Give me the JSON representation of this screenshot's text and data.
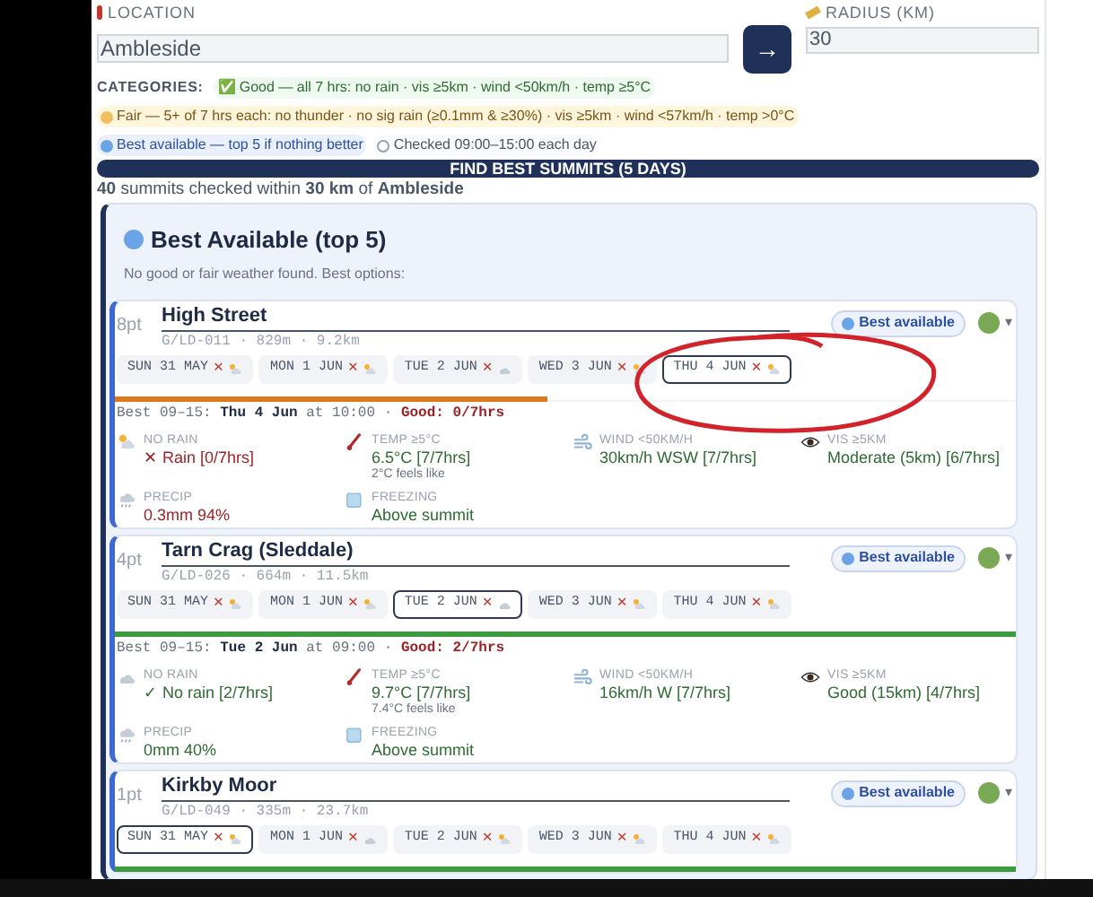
{
  "location": {
    "label": "LOCATION",
    "value": "Ambleside",
    "go": "→"
  },
  "radius": {
    "label": "RADIUS (KM)",
    "value": "30"
  },
  "categories": {
    "label": "CATEGORIES:",
    "items": [
      {
        "kind": "good",
        "icon": "✅",
        "text": "Good — all 7 hrs: no rain · vis ≥5km · wind <50km/h · temp ≥5°C"
      },
      {
        "kind": "fair",
        "text": "Fair — 5+ of 7 hrs each: no thunder · no sig rain (≥0.1mm & ≥30%) · vis ≥5km · wind <57km/h · temp >0°C"
      },
      {
        "kind": "best",
        "text": "Best available — top 5 if nothing better"
      },
      {
        "kind": "info",
        "text": "Checked 09:00–15:00 each day"
      }
    ]
  },
  "find_button": "FIND BEST SUMMITS (5 DAYS)",
  "summary": "**40** summits checked within **30 km** of **Ambleside**",
  "panel": {
    "title": "Best Available (top 5)",
    "subtitle": "No good or fair weather found. Best options:",
    "cards": [
      {
        "points": "8pt",
        "name": "High Street",
        "meta": "G/LD-011 · 829m · 9.2km",
        "badge": "Best available",
        "caret": "▾",
        "days": [
          {
            "label": "SUN 31 MAY",
            "mark": "✕",
            "kind": "sunny",
            "selected": false
          },
          {
            "label": "MON 1 JUN",
            "mark": "✕",
            "kind": "sunny",
            "selected": false
          },
          {
            "label": "TUE 2 JUN",
            "mark": "✕",
            "kind": "cloudy",
            "selected": false
          },
          {
            "label": "WED 3 JUN",
            "mark": "✕",
            "kind": "sunny",
            "selected": false
          },
          {
            "label": "THU 4 JUN",
            "mark": "✕",
            "kind": "sunny",
            "selected": true
          }
        ],
        "bar": {
          "level": 0.48,
          "color": "#d97b1e"
        },
        "best": "Best 09–15: **Thu 4 Jun** at 10:00 · ",
        "good": "Good: 0/7hrs",
        "metrics": [
          {
            "label": "NO RAIN",
            "value": "✕ Rain [0/7hrs]",
            "ok": false
          },
          {
            "label": "TEMP ≥5°C",
            "value": "6.5°C [7/7hrs]",
            "sub": "2°C feels like",
            "ok": true
          },
          {
            "label": "WIND <50KM/H",
            "value": "30km/h WSW [7/7hrs]",
            "ok": true
          },
          {
            "label": "VIS ≥5KM",
            "value": "Moderate (5km) [6/7hrs]",
            "ok": true
          },
          {
            "label": "PRECIP",
            "value": "0.3mm 94%",
            "ok": false
          },
          {
            "label": "FREEZING",
            "value": "Above summit",
            "ok": true
          }
        ]
      },
      {
        "points": "4pt",
        "name": "Tarn Crag (Sleddale)",
        "meta": "G/LD-026 · 664m · 11.5km",
        "badge": "Best available",
        "caret": "▾",
        "days": [
          {
            "label": "SUN 31 MAY",
            "mark": "✕",
            "kind": "sunny",
            "selected": false
          },
          {
            "label": "MON 1 JUN",
            "mark": "✕",
            "kind": "sunny",
            "selected": false
          },
          {
            "label": "TUE 2 JUN",
            "mark": "✕",
            "kind": "cloudy",
            "selected": true
          },
          {
            "label": "WED 3 JUN",
            "mark": "✕",
            "kind": "sunny",
            "selected": false
          },
          {
            "label": "THU 4 JUN",
            "mark": "✕",
            "kind": "sunny",
            "selected": false
          }
        ],
        "bar": {
          "level": 1,
          "color": "#3d9a40"
        },
        "best": "Best 09–15: **Tue 2 Jun** at 09:00 · ",
        "good": "Good: 2/7hrs",
        "metrics": [
          {
            "label": "NO RAIN",
            "value": "✓ No rain [2/7hrs]",
            "ok": true
          },
          {
            "label": "TEMP ≥5°C",
            "value": "9.7°C [7/7hrs]",
            "sub": "7.4°C feels like",
            "ok": true
          },
          {
            "label": "WIND <50KM/H",
            "value": "16km/h W [7/7hrs]",
            "ok": true
          },
          {
            "label": "VIS ≥5KM",
            "value": "Good (15km) [4/7hrs]",
            "ok": true
          },
          {
            "label": "PRECIP",
            "value": "0mm 40%",
            "ok": true
          },
          {
            "label": "FREEZING",
            "value": "Above summit",
            "ok": true
          }
        ]
      },
      {
        "points": "1pt",
        "name": "Kirkby Moor",
        "meta": "G/LD-049 · 335m · 23.7km",
        "badge": "Best available",
        "caret": "▾",
        "days": [
          {
            "label": "SUN 31 MAY",
            "mark": "✕",
            "kind": "sunny",
            "selected": true
          },
          {
            "label": "MON 1 JUN",
            "mark": "✕",
            "kind": "cloudy",
            "selected": false
          },
          {
            "label": "TUE 2 JUN",
            "mark": "✕",
            "kind": "sunny",
            "selected": false
          },
          {
            "label": "WED 3 JUN",
            "mark": "✕",
            "kind": "sunny",
            "selected": false
          },
          {
            "label": "THU 4 JUN",
            "mark": "✕",
            "kind": "sunny",
            "selected": false
          }
        ],
        "bar": {
          "level": 1,
          "color": "#3d9a40"
        }
      }
    ]
  }
}
